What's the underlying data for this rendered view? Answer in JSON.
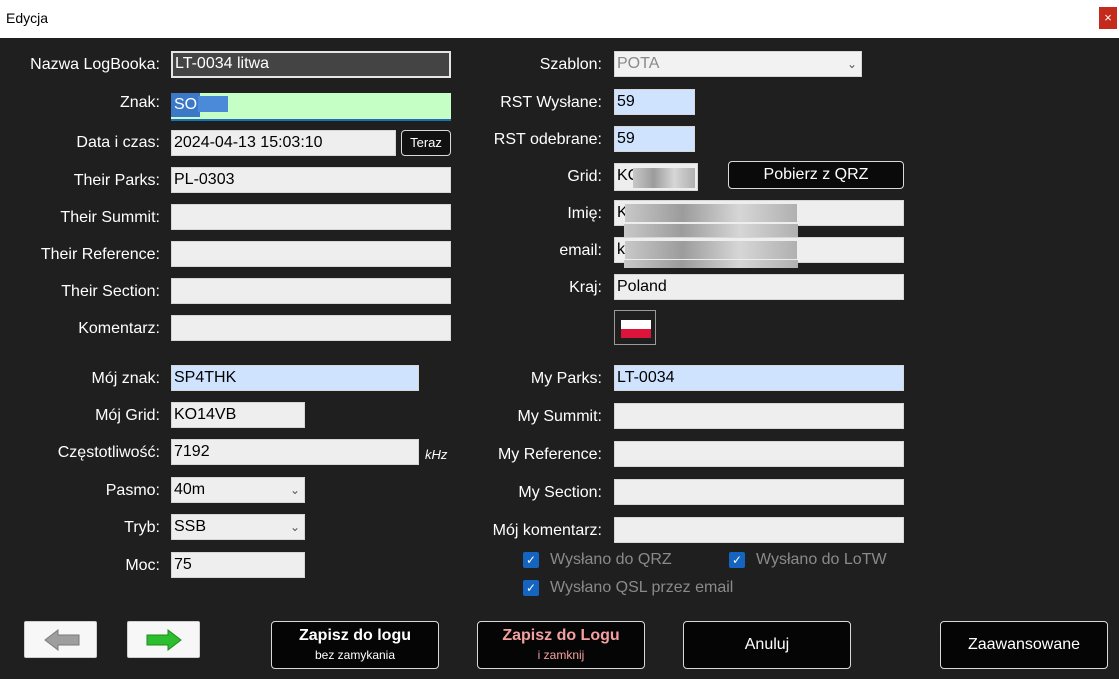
{
  "window": {
    "title": "Edycja",
    "close_glyph": "×"
  },
  "left": {
    "logbook_label": "Nazwa LogBooka:",
    "logbook_value": "LT-0034 litwa",
    "call_label": "Znak:",
    "call_value": "SO",
    "datetime_label": "Data i czas:",
    "datetime_value": "2024-04-13 15:03:10",
    "now_button": "Teraz",
    "their_parks_label": "Their Parks:",
    "their_parks_value": "PL-0303",
    "their_summit_label": "Their Summit:",
    "their_summit_value": "",
    "their_reference_label": "Their Reference:",
    "their_reference_value": "",
    "their_section_label": "Their Section:",
    "their_section_value": "",
    "comment_label": "Komentarz:",
    "comment_value": "",
    "my_call_label": "Mój znak:",
    "my_call_value": "SP4THK",
    "my_grid_label": "Mój Grid:",
    "my_grid_value": "KO14VB",
    "freq_label": "Częstotliwość:",
    "freq_value": "7192",
    "freq_unit": "kHz",
    "band_label": "Pasmo:",
    "band_value": "40m",
    "mode_label": "Tryb:",
    "mode_value": "SSB",
    "power_label": "Moc:",
    "power_value": "75"
  },
  "right": {
    "template_label": "Szablon:",
    "template_value": "POTA",
    "rst_sent_label": "RST Wysłane:",
    "rst_sent_value": "59",
    "rst_rcvd_label": "RST odebrane:",
    "rst_rcvd_value": "59",
    "grid_label": "Grid:",
    "grid_value": "KC",
    "qrz_button": "Pobierz z QRZ",
    "name_label": "Imię:",
    "name_value": "K",
    "email_label": "email:",
    "email_value": "k",
    "country_label": "Kraj:",
    "country_value": "Poland",
    "my_parks_label": "My Parks:",
    "my_parks_value": "LT-0034",
    "my_summit_label": "My Summit:",
    "my_summit_value": "",
    "my_reference_label": "My Reference:",
    "my_reference_value": "",
    "my_section_label": "My Section:",
    "my_section_value": "",
    "my_comment_label": "Mój komentarz:",
    "my_comment_value": "",
    "sent_qrz": "Wysłano do QRZ",
    "sent_lotw": "Wysłano do LoTW",
    "sent_qsl_email": "Wysłano QSL przez email",
    "check_glyph": "✓"
  },
  "footer": {
    "save_log_title": "Zapisz do logu",
    "save_log_sub": "bez zamykania",
    "save_close_title": "Zapisz do Logu",
    "save_close_sub": "i zamknij",
    "cancel": "Anuluj",
    "advanced": "Zaawansowane"
  },
  "colors": {
    "accent_red": "#f4a0a0",
    "flag_white": "#ffffff",
    "flag_red": "#dc143c",
    "arrow_green": "#2dbe2d",
    "arrow_gray": "#9e9e9e"
  }
}
